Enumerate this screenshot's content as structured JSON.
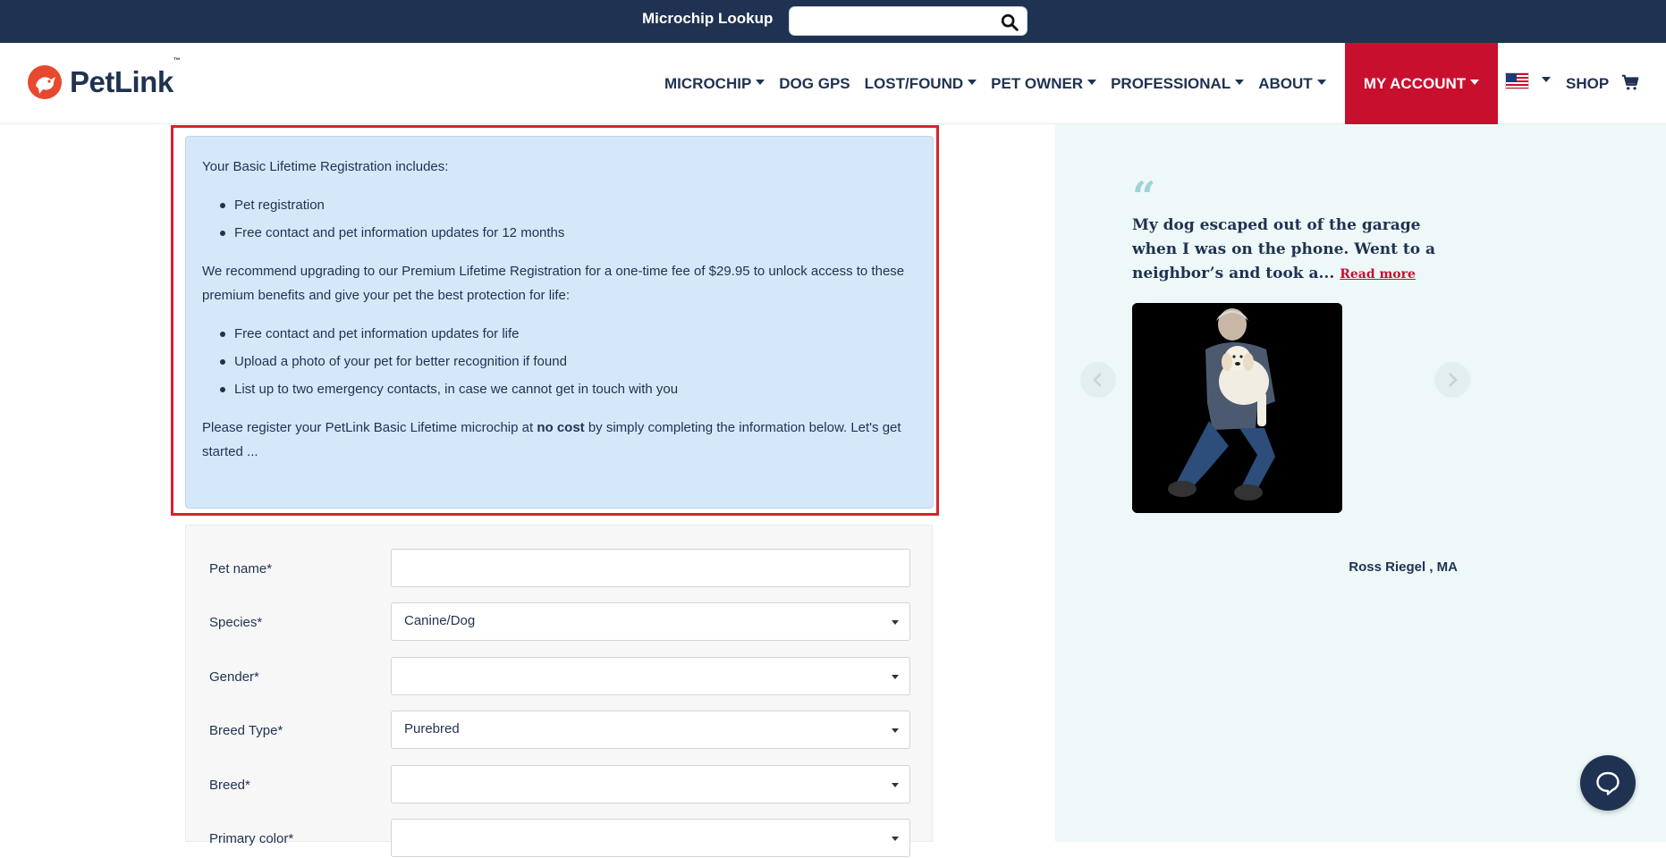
{
  "topbar": {
    "lookup_label": "Microchip Lookup",
    "lookup_value": ""
  },
  "brand": {
    "name": "PetLink",
    "tm": "™",
    "accent_color": "#c8102e",
    "navy_color": "#1f3251"
  },
  "nav": {
    "microchip": "MICROCHIP",
    "dog_gps": "DOG GPS",
    "lost_found": "LOST/FOUND",
    "pet_owner": "PET OWNER",
    "professional": "PROFESSIONAL",
    "about": "ABOUT",
    "my_account": "MY ACCOUNT",
    "shop": "SHOP"
  },
  "info": {
    "intro": "Your Basic Lifetime Registration includes:",
    "basic_items": [
      "Pet registration",
      "Free contact and pet information updates for 12 months"
    ],
    "upgrade": "We recommend upgrading to our Premium Lifetime Registration for a one-time fee of $29.95 to unlock access to these premium benefits and give your pet the best protection for life:",
    "premium_items": [
      "Free contact and pet information updates for life",
      "Upload a photo of your pet for better recognition if found",
      "List up to two emergency contacts, in case we cannot get in touch with you"
    ],
    "closing_before": "Please register your PetLink Basic Lifetime microchip at ",
    "closing_bold": "no cost",
    "closing_after": " by simply completing the information below. Let's get started ..."
  },
  "form": {
    "fields": [
      {
        "label": "Pet name*",
        "value": ""
      },
      {
        "label": "Species*",
        "value": "Canine/Dog"
      },
      {
        "label": "Gender*",
        "value": ""
      },
      {
        "label": "Breed Type*",
        "value": "Purebred"
      },
      {
        "label": "Breed*",
        "value": ""
      },
      {
        "label": "Primary color*",
        "value": ""
      }
    ]
  },
  "testimonial": {
    "quote": "My dog escaped out of the garage when I was on the phone. Went to a neighbor’s and took a...",
    "read_more": "Read more",
    "author": "Ross Riegel , MA"
  },
  "icons": {
    "search": "search-icon",
    "cart": "cart-icon",
    "flag": "us-flag-icon",
    "chat": "chat-icon",
    "prev": "chevron-left-icon",
    "next": "chevron-right-icon"
  }
}
